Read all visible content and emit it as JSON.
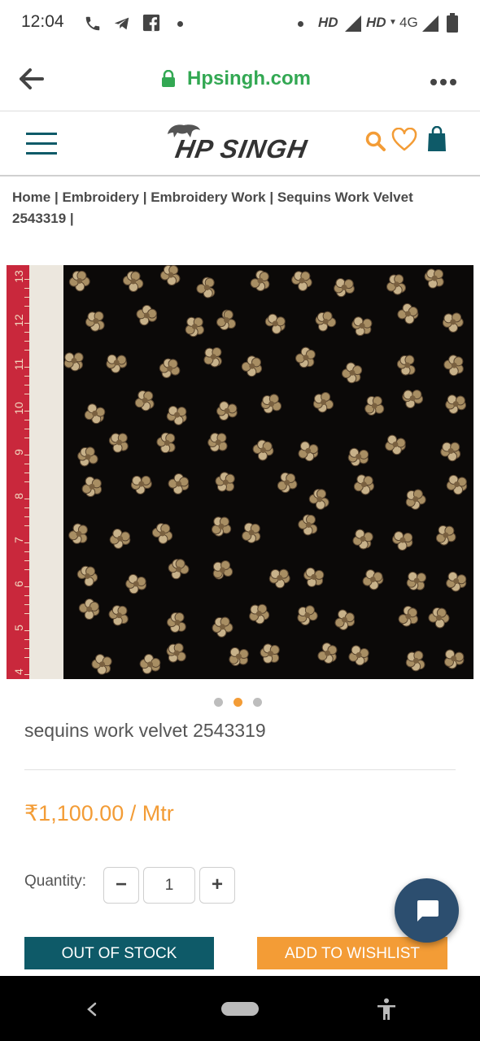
{
  "status_bar": {
    "time": "12:04",
    "net1": "HD",
    "net2": "HD",
    "net3": "4G"
  },
  "browser": {
    "url": "Hpsingh.com",
    "back_icon": "arrow-left-icon",
    "menu_icon": "more-vert-icon"
  },
  "site": {
    "logo": "HP SINGH",
    "icons": [
      "hamburger-icon",
      "search-icon",
      "heart-icon",
      "shopping-bag-icon"
    ]
  },
  "breadcrumb": {
    "home": "Home",
    "sep": "|",
    "embroidery": "Embroidery",
    "embroidery_work": "Embroidery Work",
    "current": "Sequins Work Velvet 2543319"
  },
  "product": {
    "title": "sequins work velvet 2543319",
    "price": "₹1,100.00 / Mtr",
    "quantity_label": "Quantity:",
    "quantity_value": "1",
    "minus": "−",
    "plus": "+",
    "out_of_stock": "OUT OF STOCK",
    "add_to_wishlist": "ADD TO WISHLIST",
    "ruler_numbers": [
      "13",
      "12",
      "11",
      "10",
      "9",
      "8",
      "7",
      "6",
      "5",
      "4"
    ]
  },
  "colors": {
    "brand_teal": "#0e5a68",
    "accent_orange": "#f39c36",
    "url_green": "#33a853"
  }
}
